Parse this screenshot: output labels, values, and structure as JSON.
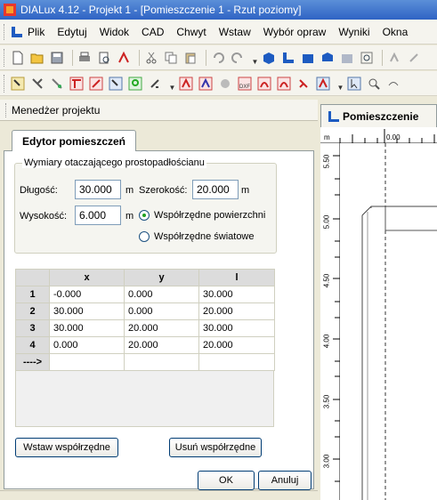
{
  "window": {
    "title": "DIALux 4.12 - Projekt 1 - [Pomieszczenie 1 - Rzut poziomy]"
  },
  "menu": {
    "items": [
      "Plik",
      "Edytuj",
      "Widok",
      "CAD",
      "Chwyt",
      "Wstaw",
      "Wybór opraw",
      "Wyniki",
      "Okna"
    ]
  },
  "toolbar1": {
    "icons": [
      "new-file-icon",
      "open-folder-icon",
      "save-icon",
      "print-icon",
      "print-preview-icon",
      "pdf-icon",
      "cut-icon",
      "copy-icon",
      "paste-icon",
      "undo-icon",
      "redo-icon",
      "view-3d-icon",
      "view-plan-icon",
      "view-front-icon",
      "view-side-icon",
      "view-shaded-icon",
      "zoom-window-icon",
      "pan-icon",
      "hand-icon"
    ]
  },
  "toolbar2": {
    "icons": [
      "select-tool-icon",
      "luminaire-tool-icon",
      "room-tool-icon",
      "measure-tool-icon",
      "object-tool-icon",
      "rotate-tool-icon",
      "grid-icon",
      "luminaire-red-icon",
      "luminaire-outline-icon",
      "calc-icon",
      "dxf-icon",
      "isolines-icon",
      "luminaire-a-icon",
      "luminaire-b-icon",
      "report-icon",
      "pointer-icon",
      "zoom-icon",
      "rotate-view-icon",
      "pan-hand-icon"
    ]
  },
  "project_manager": {
    "header": "Menedżer projektu",
    "tab": "Edytor pomieszczeń",
    "group_title": "Wymiary otaczającego prostopadłościanu",
    "length_label": "Długość:",
    "length_value": "30.000",
    "length_unit": "m",
    "width_label": "Szerokość:",
    "width_value": "20.000",
    "width_unit": "m",
    "height_label": "Wysokość:",
    "height_value": "6.000",
    "height_unit": "m",
    "radio_surface": "Współrzędne powierzchni",
    "radio_world": "Współrzędne światowe",
    "radio_selected": "surface"
  },
  "table": {
    "headers": [
      "",
      "x",
      "y",
      "l"
    ],
    "rows": [
      {
        "label": "1",
        "x": "-0.000",
        "y": "0.000",
        "l": "30.000"
      },
      {
        "label": "2",
        "x": "30.000",
        "y": "0.000",
        "l": "20.000"
      },
      {
        "label": "3",
        "x": "30.000",
        "y": "20.000",
        "l": "30.000"
      },
      {
        "label": "4",
        "x": "0.000",
        "y": "20.000",
        "l": "20.000"
      },
      {
        "label": "---->",
        "x": "",
        "y": "",
        "l": ""
      }
    ]
  },
  "buttons": {
    "insert": "Wstaw współrzędne",
    "remove": "Usuń współrzędne",
    "ok": "OK",
    "cancel": "Anuluj"
  },
  "document": {
    "tab": "Pomieszczenie",
    "ruler_unit": "m",
    "ruler_top_value": "0.00",
    "ruler_left_values": [
      "5.50",
      "5.00",
      "4.50",
      "4.00",
      "3.50",
      "3.00"
    ]
  }
}
